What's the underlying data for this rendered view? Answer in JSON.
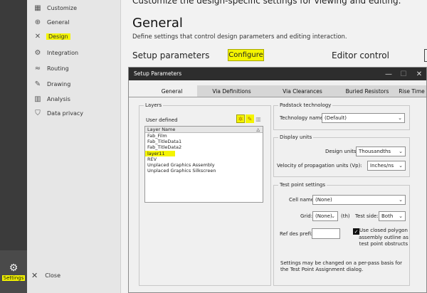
{
  "header": {
    "top_text": "Customize the design-specific settings for viewing and editing.",
    "title": "General",
    "description": "Define settings that control design parameters and editing interaction.",
    "setup_parameters": "Setup parameters",
    "configure_button": "Configure",
    "editor_control": "Editor control"
  },
  "sidebar": {
    "items": [
      {
        "label": "Customize",
        "icon": "customize-icon"
      },
      {
        "label": "General",
        "icon": "globe-icon"
      },
      {
        "label": "Design",
        "icon": "design-icon"
      },
      {
        "label": "Integration",
        "icon": "integration-icon"
      },
      {
        "label": "Routing",
        "icon": "routing-icon"
      },
      {
        "label": "Drawing",
        "icon": "drawing-icon"
      },
      {
        "label": "Analysis",
        "icon": "analysis-icon"
      },
      {
        "label": "Data privacy",
        "icon": "shield-icon"
      }
    ],
    "selected": "Design",
    "settings_label": "Settings",
    "close_label": "Close"
  },
  "dialog": {
    "title": "Setup Parameters",
    "tabs": [
      "General",
      "Via Definitions",
      "Via Clearances",
      "Buried Resistors",
      "Rise Time"
    ],
    "active_tab": "General",
    "layers": {
      "legend": "Layers",
      "selection": "User defined",
      "column_header": "Layer Name",
      "rows": [
        "Fab_Film",
        "Fab_TitleData1",
        "Fab_TitleData2",
        "layer11",
        "REV",
        "Unplaced Graphics Assembly",
        "Unplaced Graphics Silkscreen"
      ],
      "highlighted_row": "layer11"
    },
    "padstack": {
      "legend": "Padstack technology",
      "tech_label": "Technology name:",
      "tech_value": "(Default)"
    },
    "display_units": {
      "legend": "Display units",
      "design_units_label": "Design units:",
      "design_units_value": "Thousandths",
      "velocity_label": "Velocity of propagation units (Vp):",
      "velocity_value": "Inches/ns"
    },
    "test_point": {
      "legend": "Test point settings",
      "cell_label": "Cell name:",
      "cell_value": "(None)",
      "grid_label": "Grid:",
      "grid_value": "(None)",
      "grid_unit": "(th)",
      "side_label": "Test side:",
      "side_value": "Both",
      "ref_label": "Ref des prefix:",
      "ref_value": "",
      "checkbox_label": "Use closed polygon assembly outline as test point obstructs",
      "checkbox_checked": true,
      "note": "Settings may be changed on a per-pass basis for the Test Point Assignment dialog."
    }
  },
  "colors": {
    "highlight": "#f4f400",
    "titlebar": "#2d2d2d",
    "sidebar_dark": "#3b3b3b"
  }
}
